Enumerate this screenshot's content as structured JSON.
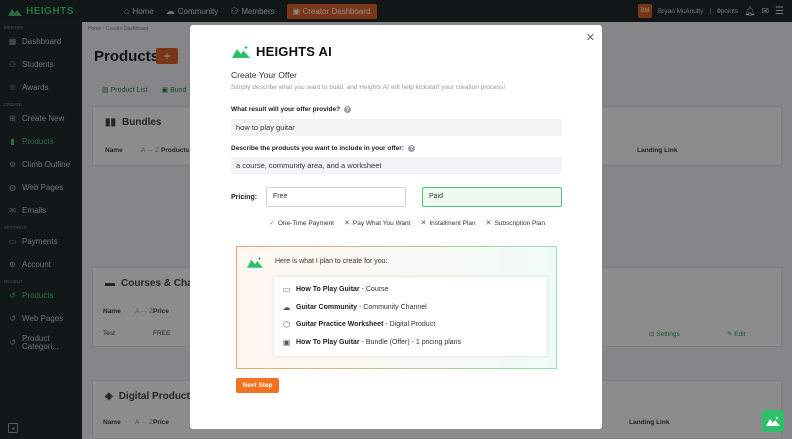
{
  "topbar": {
    "brand": "HEIGHTS",
    "nav": [
      {
        "label": "Home",
        "icon": "home-icon"
      },
      {
        "label": "Community",
        "icon": "chat-icon"
      },
      {
        "label": "Members",
        "icon": "members-icon"
      }
    ],
    "creator_dashboard": "Creator Dashboard",
    "avatar_initials": "BM",
    "user_name": "Bryan McAnulty",
    "points_value": "0",
    "points_label": "points"
  },
  "sidebar": {
    "sections": {
      "main": "MENTOR",
      "create": "CREATE",
      "settings": "SETTINGS",
      "recent": "RECENT"
    },
    "items": [
      {
        "label": "Dashboard",
        "icon": "dashboard-icon"
      },
      {
        "label": "Students",
        "icon": "students-icon"
      },
      {
        "label": "Awards",
        "icon": "award-icon"
      },
      {
        "label": "Create New",
        "icon": "plus-square-icon"
      },
      {
        "label": "Products",
        "icon": "products-icon"
      },
      {
        "label": "Climb Outline",
        "icon": "outline-icon"
      },
      {
        "label": "Web Pages",
        "icon": "globe-icon"
      },
      {
        "label": "Emails",
        "icon": "email-icon"
      },
      {
        "label": "Payments",
        "icon": "card-icon"
      },
      {
        "label": "Account",
        "icon": "gear-icon"
      },
      {
        "label": "Products",
        "icon": "history-icon"
      },
      {
        "label": "Web Pages",
        "icon": "history-icon"
      },
      {
        "label": "Product Categori...",
        "icon": "history-icon"
      }
    ]
  },
  "main": {
    "breadcrumb_home": "Home",
    "breadcrumb_sep": "›",
    "breadcrumb_current": "Creator Dashboard",
    "title": "Products",
    "tabs": [
      "Product List",
      "Bund"
    ],
    "bundles": {
      "title": "Bundles",
      "col_name": "Name",
      "col_sort": "A → Z",
      "col_products": "Products",
      "col_landing": "Landing Link"
    },
    "courses": {
      "title": "Courses & Chall",
      "col_name": "Name",
      "col_sort": "A → Z",
      "col_price": "Price",
      "row_name": "Test",
      "row_price": "FREE",
      "row_settings": "Settings",
      "row_edit": "Edit"
    },
    "digital": {
      "title": "Digital Products",
      "col_name": "Name",
      "col_sort": "A → Z",
      "col_price": "Price",
      "col_landing": "Landing Link"
    }
  },
  "modal": {
    "brand": "HEIGHTS AI",
    "title": "Create Your Offer",
    "subtitle": "Simply describe what you want to build, and Heights AI will help kickstart your creation process!",
    "q1_label": "What result will your offer provide?",
    "q1_value": "how to play guitar",
    "q2_label": "Describe the products you want to include in your offer:",
    "q2_value": "a course, community area, and a worksheet",
    "pricing_label": "Pricing:",
    "pricing_free": "Free",
    "pricing_paid": "Paid",
    "payment_options": [
      {
        "label": "One-Time Payment",
        "selected": true
      },
      {
        "label": "Pay What You Want",
        "selected": false
      },
      {
        "label": "Installment Plan",
        "selected": false
      },
      {
        "label": "Subscription Plan",
        "selected": false
      }
    ],
    "plan_heading": "Here is what I plan to create for you:",
    "plan_items": [
      {
        "name": "How To Play Guitar",
        "detail": " - Course",
        "icon": "folder-icon"
      },
      {
        "name": "Guitar Community",
        "detail": " - Community Channel",
        "icon": "community-icon"
      },
      {
        "name": "Guitar Practice Worksheet",
        "detail": " - Digital Product",
        "icon": "box-icon"
      },
      {
        "name": "How To Play Guitar",
        "detail": " - Bundle (Offer) - 1 pricing plans",
        "icon": "bundle-icon"
      }
    ],
    "next_button": "Next Step"
  },
  "colors": {
    "accent_green": "#48c774",
    "accent_orange": "#f2721f",
    "sidebar_bg": "#222b2c"
  }
}
